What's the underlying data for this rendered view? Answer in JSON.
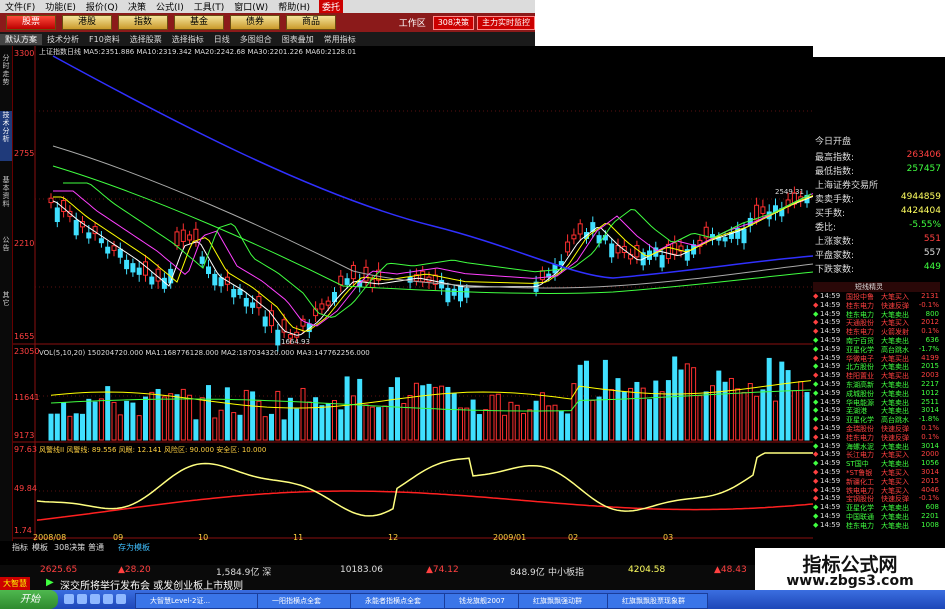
{
  "menu": {
    "items": [
      "文件(F)",
      "功能(E)",
      "报价(Q)",
      "决策",
      "公式(I)",
      "工具(T)",
      "窗口(W)",
      "帮助(H)"
    ],
    "active": "委托"
  },
  "modules": {
    "items": [
      "股票",
      "港股",
      "指数",
      "基金",
      "债券",
      "商品"
    ],
    "active": "股票",
    "workspace": "工作区",
    "buttons": [
      "308决策",
      "主力实时监控"
    ]
  },
  "toolbar": {
    "items": [
      "默认方案",
      "技术分析",
      "F10资料",
      "选择股票",
      "选择指标",
      "日线",
      "多图组合",
      "图表叠加",
      "常用指标"
    ]
  },
  "sidetabs": [
    "分时走势",
    "技术分析",
    "基本资料",
    "公告",
    "其它"
  ],
  "price_panel": {
    "header": "上证指数日线 MA5:2351.886 MA10:2319.342 MA20:2242.68 MA30:2201.226 MA60:2128.01",
    "y_labels": [
      "3300",
      "2755",
      "2210",
      "1655"
    ],
    "annot_high": "2549.31",
    "annot_low": "1664.93"
  },
  "volume_panel": {
    "header": "VOL(5,10,20) 150204720.000 MA1:168776128.000 MA2:187034320.000 MA3:147762256.000",
    "y_labels": [
      "23050",
      "11641",
      "9173"
    ]
  },
  "indicator_panel": {
    "header": "风警线II 风警线: 89.556 风眼: 12.141 风险区: 90.000 安全区: 10.000",
    "y_labels": [
      "97.63",
      "49.84",
      "1.74"
    ]
  },
  "x_labels": [
    "2008/08",
    "09",
    "10",
    "11",
    "12",
    "2009/01",
    "02",
    "03"
  ],
  "info_panel": {
    "partial_top": "今日开盘",
    "rows": [
      {
        "k": "最高指数:",
        "v": "263406",
        "color": "#ff4040"
      },
      {
        "k": "最低指数:",
        "v": "257457",
        "color": "#40ff40"
      },
      {
        "k": "上海证券交易所",
        "v": "",
        "color": "#ddd"
      },
      {
        "k": "卖卖手数:",
        "v": "4944859",
        "color": "#ffff60"
      },
      {
        "k": "买手数:",
        "v": "4424404",
        "color": "#ffff60"
      },
      {
        "k": "委比:",
        "v": "-5.55%",
        "color": "#40ff40"
      },
      {
        "k": "上涨家数:",
        "v": "551",
        "color": "#ff4040"
      },
      {
        "k": "平盘家数:",
        "v": "557",
        "color": "#ddd"
      },
      {
        "k": "下跌家数:",
        "v": "449",
        "color": "#40ff40"
      }
    ]
  },
  "tick_header": "短线精灵",
  "ticks": [
    {
      "t": "14:59",
      "n": "国投中鲁",
      "a": "大笔买入",
      "v": "2131",
      "c": "#ff4040"
    },
    {
      "t": "14:59",
      "n": "桂东电力",
      "a": "快速反弹",
      "v": "-0.1%",
      "c": "#ff4040"
    },
    {
      "t": "14:59",
      "n": "桂东电力",
      "a": "大笔卖出",
      "v": "800",
      "c": "#40ff40"
    },
    {
      "t": "14:59",
      "n": "天通股份",
      "a": "大笔买入",
      "v": "2012",
      "c": "#ff4040"
    },
    {
      "t": "14:59",
      "n": "桂东电力",
      "a": "火箭发射",
      "v": "0.1%",
      "c": "#ff4040"
    },
    {
      "t": "14:59",
      "n": "南宁百货",
      "a": "大笔卖出",
      "v": "636",
      "c": "#40ff40"
    },
    {
      "t": "14:59",
      "n": "亚星化学",
      "a": "高台跳水",
      "v": "-1.7%",
      "c": "#40ff40"
    },
    {
      "t": "14:59",
      "n": "华微电子",
      "a": "大笔买出",
      "v": "4199",
      "c": "#ff4040"
    },
    {
      "t": "14:59",
      "n": "北方股份",
      "a": "大笔卖出",
      "v": "2015",
      "c": "#40ff40"
    },
    {
      "t": "14:59",
      "n": "桂阳置业",
      "a": "大笔买出",
      "v": "2003",
      "c": "#ff4040"
    },
    {
      "t": "14:59",
      "n": "东湖高新",
      "a": "大笔卖出",
      "v": "2217",
      "c": "#40ff40"
    },
    {
      "t": "14:59",
      "n": "成城股份",
      "a": "大笔卖出",
      "v": "1012",
      "c": "#40ff40"
    },
    {
      "t": "14:59",
      "n": "华电能源",
      "a": "大笔卖出",
      "v": "2511",
      "c": "#40ff40"
    },
    {
      "t": "14:59",
      "n": "芜湖港",
      "a": "大笔卖出",
      "v": "3014",
      "c": "#40ff40"
    },
    {
      "t": "14:59",
      "n": "亚星化学",
      "a": "高台跳水",
      "v": "-1.8%",
      "c": "#40ff40"
    },
    {
      "t": "14:59",
      "n": "金瑞股份",
      "a": "快速反弹",
      "v": "0.1%",
      "c": "#ff4040"
    },
    {
      "t": "14:59",
      "n": "桂东电力",
      "a": "快速反弹",
      "v": "0.1%",
      "c": "#ff4040"
    },
    {
      "t": "14:59",
      "n": "海螺水泥",
      "a": "大笔卖出",
      "v": "3014",
      "c": "#40ff40"
    },
    {
      "t": "14:59",
      "n": "长江电力",
      "a": "大笔买入",
      "v": "2000",
      "c": "#ff4040"
    },
    {
      "t": "14:59",
      "n": "ST国中",
      "a": "大笔卖出",
      "v": "1056",
      "c": "#40ff40"
    },
    {
      "t": "14:59",
      "n": "*ST鲁银",
      "a": "大笔买入",
      "v": "3014",
      "c": "#ff4040"
    },
    {
      "t": "14:59",
      "n": "新疆化工",
      "a": "大笔买入",
      "v": "2015",
      "c": "#ff4040"
    },
    {
      "t": "14:59",
      "n": "铁电电力",
      "a": "大笔买入",
      "v": "4046",
      "c": "#ff4040"
    },
    {
      "t": "14:59",
      "n": "宝钢股份",
      "a": "快速反弹",
      "v": "-0.1%",
      "c": "#ff4040"
    },
    {
      "t": "14:59",
      "n": "亚星化学",
      "a": "大笔卖出",
      "v": "608",
      "c": "#40ff40"
    },
    {
      "t": "14:59",
      "n": "中国联通",
      "a": "大笔卖出",
      "v": "2201",
      "c": "#40ff40"
    },
    {
      "t": "14:59",
      "n": "桂东电力",
      "a": "大笔卖出",
      "v": "1008",
      "c": "#40ff40"
    }
  ],
  "bottom_tabs": [
    "指标",
    "模板",
    "308决策",
    "普通",
    "存为模板"
  ],
  "status": {
    "left": "1,584.9亿 深",
    "v1": "2625.65",
    "c1": "▲28.20",
    "v2": "10183.06",
    "c2": "▲74.12",
    "v3": "848.9亿",
    "v4": "4204.58",
    "c4": "▲48.43",
    "label": "中小板指"
  },
  "ticker": {
    "brand": "大智慧",
    "text": "深交所将举行发布会 或发创业板上市规则"
  },
  "taskbar": {
    "start": "开始",
    "items": [
      "大智慧Level-2证...",
      "一阳指横点全套",
      "永能者指横点全套",
      "钱龙旗舰2007",
      "红旗飘飘强动群",
      "红旗飘飘股票现象群"
    ]
  },
  "watermark": {
    "line1": "指标公式网",
    "line2": "www.zbgs3.com"
  }
}
